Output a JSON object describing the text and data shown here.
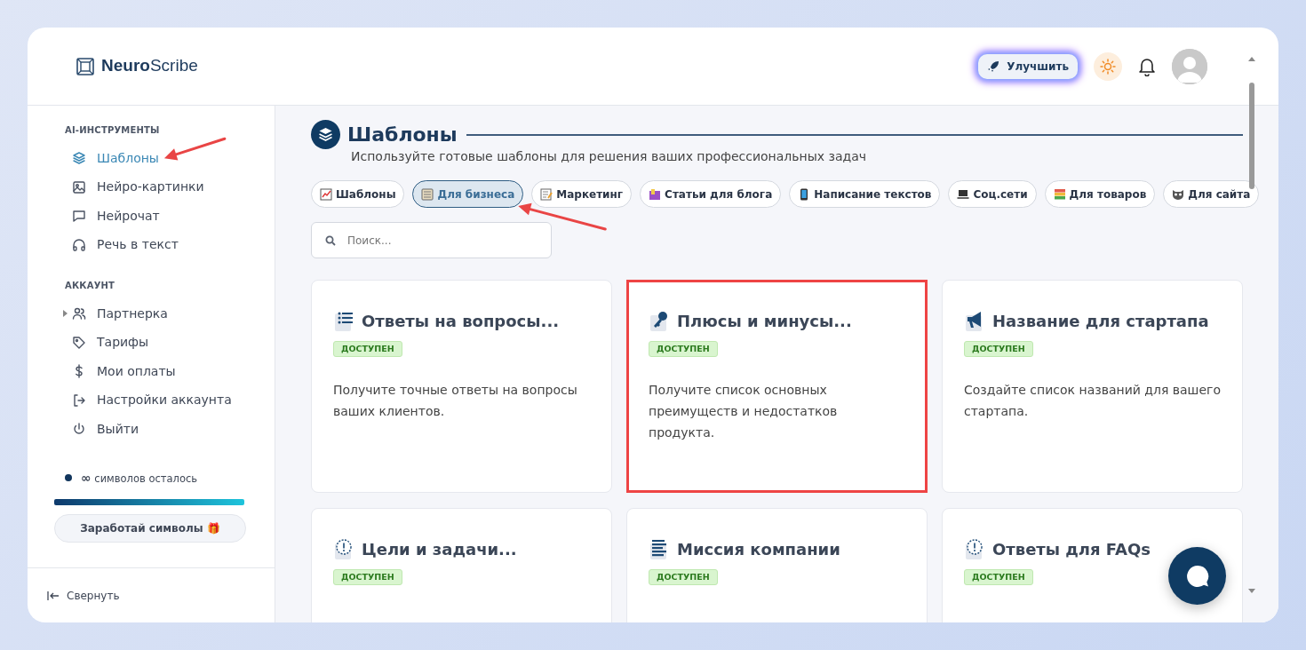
{
  "logo": {
    "text": "**Neuro**Scribe"
  },
  "header": {
    "upgrade_button": "Улучшить"
  },
  "sidebar": {
    "sections": [
      {
        "title": "AI-ИНСТРУМЕНТЫ",
        "items": [
          {
            "label": "Шаблоны",
            "selected": true,
            "annotated": true
          },
          {
            "label": "Нейро-картинки",
            "selected": false,
            "annotated": false
          },
          {
            "label": "Нейрочат",
            "selected": false,
            "annotated": false
          },
          {
            "label": "Речь в текст",
            "selected": false,
            "annotated": false
          }
        ]
      },
      {
        "title": "АККАУНТ",
        "items": [
          {
            "label": "Партнерка",
            "selected": false,
            "annotated": false,
            "expandable": true
          },
          {
            "label": "Тарифы",
            "selected": false,
            "annotated": false
          },
          {
            "label": "Мои оплаты",
            "selected": false,
            "annotated": false
          },
          {
            "label": "Настройки аккаунта",
            "selected": false,
            "annotated": false
          },
          {
            "label": "Выйти",
            "selected": false,
            "annotated": false
          }
        ]
      }
    ],
    "credits": {
      "symbol": "∞",
      "text": "символов осталось",
      "level": 1
    },
    "earn_button": "Заработай символы 🎁",
    "collapse": "Свернуть"
  },
  "page": {
    "title": "Шаблоны",
    "subtitle": "Используйте готовые шаблоны для решения ваших профессиональных задач"
  },
  "categories": [
    {
      "label": "Шаблоны",
      "selected": false,
      "annotated": false
    },
    {
      "label": "Для бизнеса",
      "selected": true,
      "annotated": true
    },
    {
      "label": "Маркетинг",
      "selected": false,
      "annotated": false
    },
    {
      "label": "Статьи для блога",
      "selected": false,
      "annotated": false
    },
    {
      "label": "Написание текстов",
      "selected": false,
      "annotated": false
    },
    {
      "label": "Соц.сети",
      "selected": false,
      "annotated": false
    },
    {
      "label": "Для товаров",
      "selected": false,
      "annotated": false
    },
    {
      "label": "Для сайта",
      "selected": false,
      "annotated": false
    }
  ],
  "search": {
    "placeholder": "Поиск..."
  },
  "templates": [
    {
      "title": "Ответы на вопросы...",
      "badge": "ДОСТУПЕН",
      "description": "Получите точные ответы на вопросы ваших клиентов.",
      "highlighted": false
    },
    {
      "title": "Плюсы и минусы...",
      "badge": "ДОСТУПЕН",
      "description": "Получите список основных преимуществ и недостатков продукта.",
      "highlighted": true
    },
    {
      "title": "Название для стартапа",
      "badge": "ДОСТУПЕН",
      "description": "Создайте список названий для вашего стартапа.",
      "highlighted": false
    },
    {
      "title": "Цели и задачи...",
      "badge": "ДОСТУПЕН",
      "highlighted": false
    },
    {
      "title": "Миссия компании",
      "badge": "ДОСТУПЕН",
      "highlighted": false
    },
    {
      "title": "Ответы для FAQs",
      "badge": "ДОСТУПЕН",
      "highlighted": false
    }
  ]
}
